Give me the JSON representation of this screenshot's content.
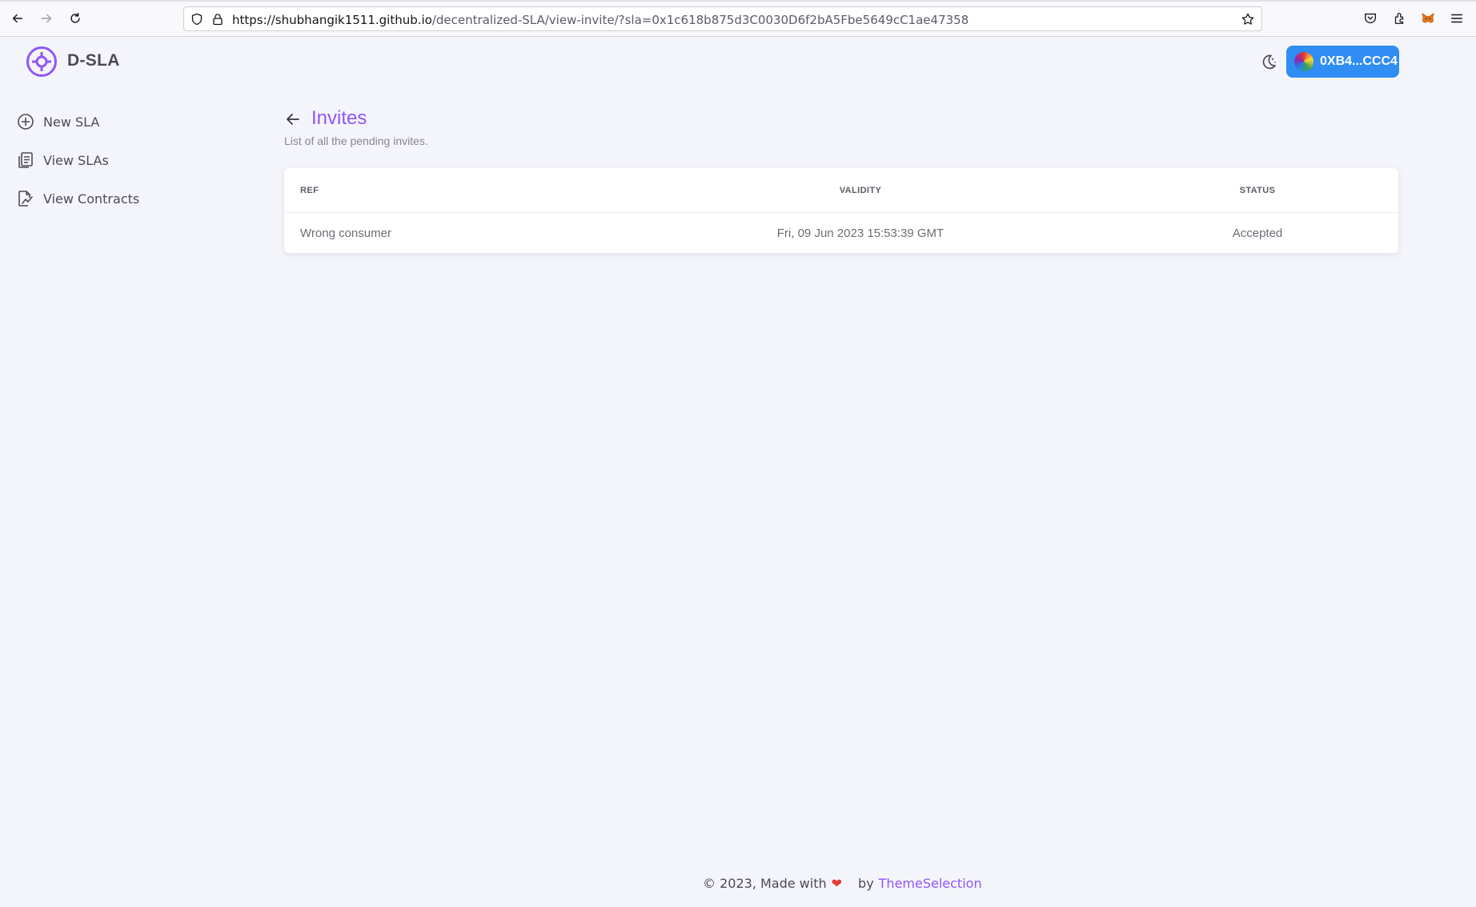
{
  "browser": {
    "url_host": "https://shubhangik1511.github.io",
    "url_path": "/decentralized-SLA/view-invite/?sla=0x1c618b875d3C0030D6f2bA5Fbe5649cC1ae47358"
  },
  "app": {
    "brand": "D-SLA",
    "accent_color": "#9155fd",
    "wallet_label": "0XB4...CCC4",
    "wallet_color": "#2f8df3"
  },
  "sidebar": {
    "items": [
      {
        "label": "New SLA",
        "icon": "plus-circle-icon"
      },
      {
        "label": "View SLAs",
        "icon": "documents-icon"
      },
      {
        "label": "View Contracts",
        "icon": "contract-chart-icon"
      }
    ]
  },
  "page": {
    "title": "Invites",
    "subtitle": "List of all the pending invites."
  },
  "table": {
    "headers": [
      "REF",
      "VALIDITY",
      "STATUS"
    ],
    "rows": [
      [
        "Wrong consumer",
        "Fri, 09 Jun 2023 15:53:39 GMT",
        "Accepted"
      ]
    ]
  },
  "footer": {
    "text": "© 2023, Made with",
    "by": "by",
    "link": "ThemeSelection"
  }
}
